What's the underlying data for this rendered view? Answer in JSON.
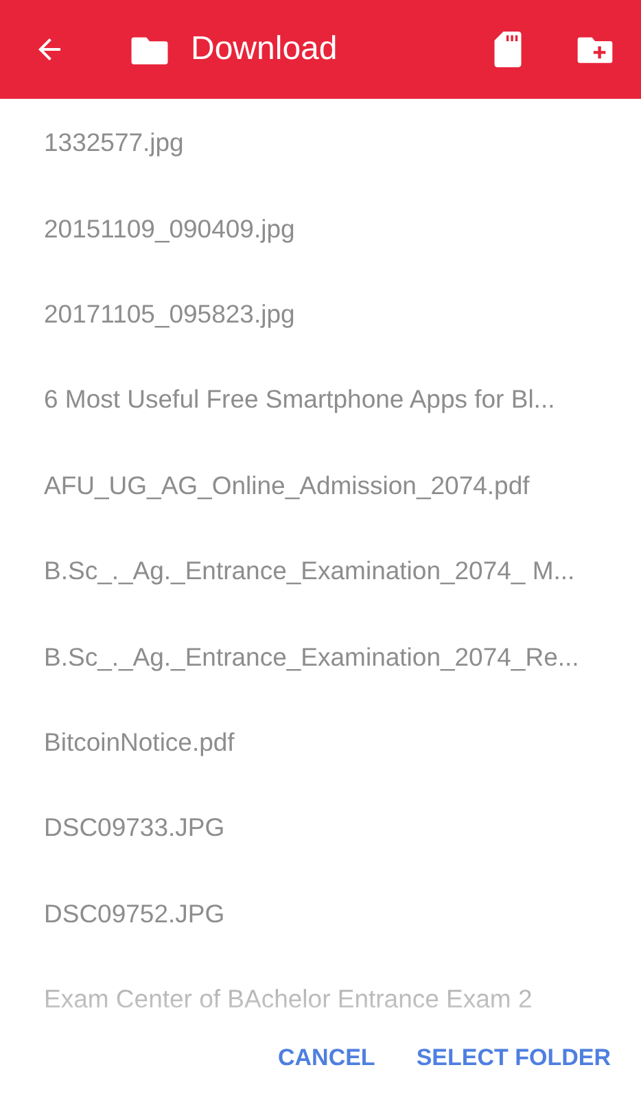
{
  "toolbar": {
    "title": "Download"
  },
  "files": [
    {
      "name": "1332577.jpg"
    },
    {
      "name": "20151109_090409.jpg"
    },
    {
      "name": "20171105_095823.jpg"
    },
    {
      "name": "6 Most Useful Free Smartphone Apps for Bl..."
    },
    {
      "name": "AFU_UG_AG_Online_Admission_2074.pdf"
    },
    {
      "name": "B.Sc_._Ag._Entrance_Examination_2074_ M..."
    },
    {
      "name": "B.Sc_._Ag._Entrance_Examination_2074_Re..."
    },
    {
      "name": "BitcoinNotice.pdf"
    },
    {
      "name": "DSC09733.JPG"
    },
    {
      "name": "DSC09752.JPG"
    },
    {
      "name": "Exam Center of BAchelor Entrance Exam 2"
    }
  ],
  "buttons": [
    {
      "label": "CANCEL"
    },
    {
      "label": "SELECT FOLDER"
    }
  ]
}
